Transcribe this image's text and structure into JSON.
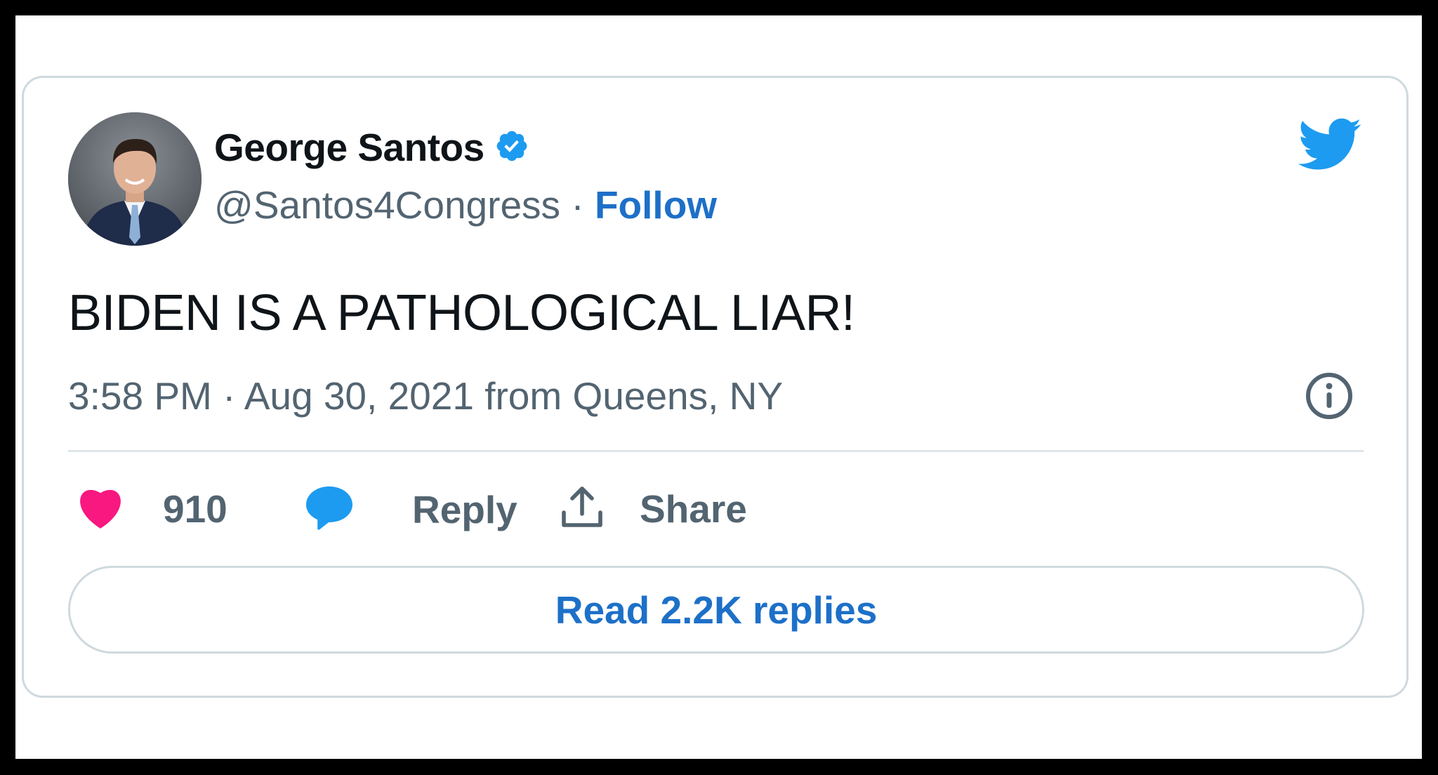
{
  "tweet": {
    "author": {
      "name": "George Santos",
      "handle": "@Santos4Congress",
      "verified": true,
      "follow_label": "Follow",
      "separator": "·"
    },
    "text": "BIDEN IS A PATHOLOGICAL LIAR!",
    "meta": {
      "time": "3:58 PM",
      "separator": "·",
      "date": "Aug 30, 2021",
      "source": "from Queens, NY"
    },
    "actions": {
      "likes": "910",
      "reply_label": "Reply",
      "share_label": "Share"
    },
    "read_replies_label": "Read 2.2K replies"
  },
  "icons": {
    "like": "heart-icon",
    "reply": "speech-bubble-icon",
    "share": "upload-arrow-icon",
    "info": "info-circle-icon",
    "brand": "twitter-bird-icon",
    "verified": "verified-badge-icon"
  },
  "colors": {
    "like": "#f91880",
    "reply": "#1d9bf0",
    "brand": "#1d9bf0",
    "link": "#1d70c8",
    "text": "#0f1419",
    "secondary": "#536471",
    "border": "#cfd9de"
  }
}
